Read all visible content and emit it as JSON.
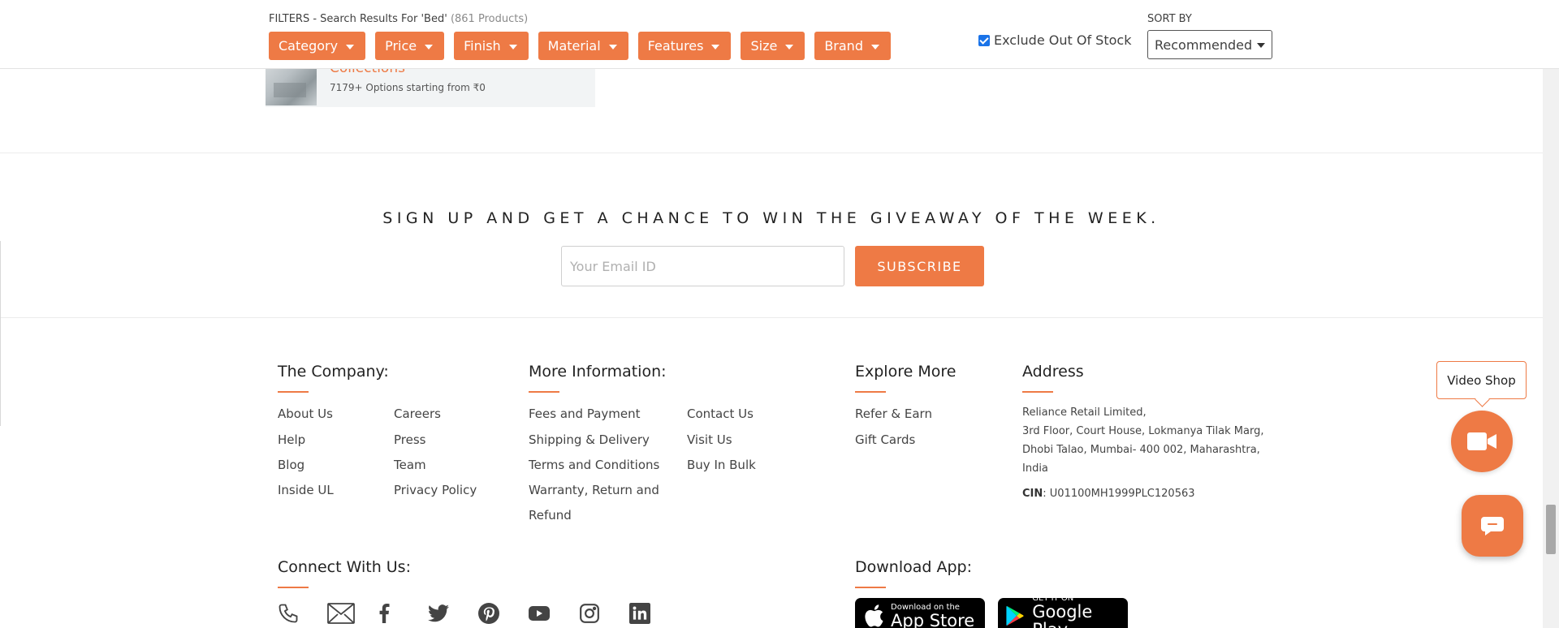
{
  "filters": {
    "title_prefix": "FILTERS - Search Results For 'Bed'",
    "count": "(861 Products)",
    "buttons": [
      "Category",
      "Price",
      "Finish",
      "Material",
      "Features",
      "Size",
      "Brand"
    ],
    "exclude_label": "Exclude Out Of Stock",
    "exclude_checked": true,
    "sort_label": "SORT BY",
    "sort_value": "Recommended"
  },
  "collections": {
    "title": "Collections",
    "subtitle": "7179+ Options starting from ₹0"
  },
  "signup": {
    "heading": "SIGN UP AND GET A CHANCE TO WIN THE GIVEAWAY OF THE WEEK.",
    "email_placeholder": "Your Email ID",
    "email_value": "",
    "button": "SUBSCRIBE"
  },
  "footer": {
    "company": {
      "heading": "The Company:",
      "col1": [
        "About Us",
        "Help",
        "Blog",
        "Inside UL"
      ],
      "col2": [
        "Careers",
        "Press",
        "Team",
        "Privacy Policy"
      ]
    },
    "more_info": {
      "heading": "More Information:",
      "col1": [
        "Fees and Payment",
        "Shipping & Delivery",
        "Terms and Conditions",
        "Warranty, Return and",
        "Refund"
      ],
      "col2": [
        "Contact Us",
        "Visit Us",
        "Buy In Bulk"
      ]
    },
    "explore": {
      "heading": "Explore More",
      "items": [
        "Refer & Earn",
        "Gift Cards"
      ]
    },
    "address": {
      "heading": "Address",
      "lines": [
        "Reliance Retail Limited,",
        "3rd Floor, Court House, Lokmanya Tilak Marg,",
        "Dhobi Talao, Mumbai- 400 002, Maharashtra,",
        "India"
      ],
      "cin_label": "CIN",
      "cin_value": ": U01100MH1999PLC120563"
    },
    "connect": {
      "heading": "Connect With Us:",
      "icons": [
        "phone-icon",
        "mail-icon",
        "facebook-icon",
        "twitter-icon",
        "pinterest-icon",
        "youtube-icon",
        "instagram-icon",
        "linkedin-icon"
      ]
    },
    "download": {
      "heading": "Download App:",
      "appstore_small": "Download on the",
      "appstore_big": "App Store",
      "googleplay_small": "GET IT ON",
      "googleplay_big": "Google Play"
    }
  },
  "widgets": {
    "video_label": "Video Shop"
  },
  "colors": {
    "accent": "#ee7a45",
    "text": "#3a3a3a"
  }
}
